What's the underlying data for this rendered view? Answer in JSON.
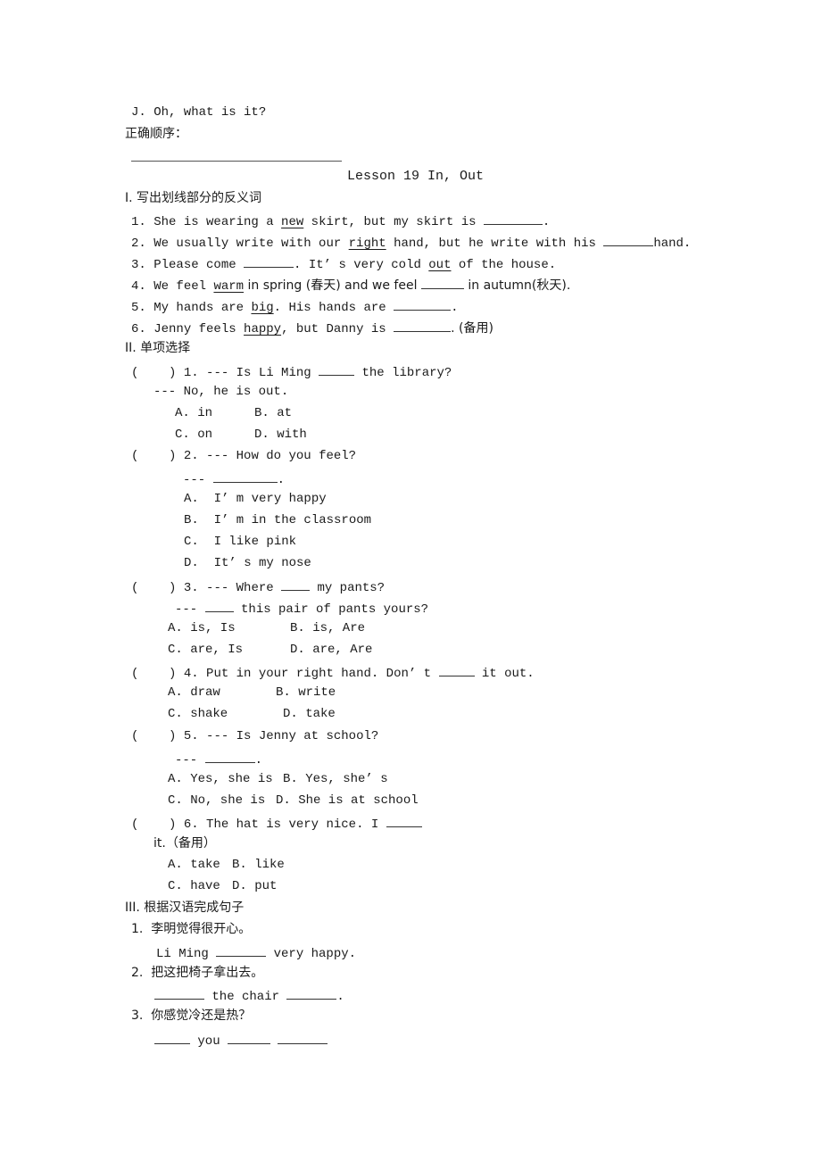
{
  "top": {
    "item_j": "J. Oh, what is it?",
    "order_label": "正确顺序："
  },
  "lesson_title": "Lesson 19 In, Out",
  "section1": {
    "heading": "I. 写出划线部分的反义词",
    "items": [
      {
        "num": "1.",
        "pre": "She is wearing a ",
        "underlined": "new",
        "post": " skirt, but my skirt is ",
        "end": "."
      },
      {
        "num": "2.",
        "pre": "We usually write with our ",
        "underlined": "right",
        "post": " hand, but he write with his ",
        "end": "hand."
      },
      {
        "num": "3.",
        "pre": "Please come ",
        "mid": ". It’ s very cold ",
        "underlined": "out",
        "post": " of the house."
      },
      {
        "num": "4.",
        "pre": "We feel ",
        "underlined": "warm",
        "post": " in spring (春天) and we feel ",
        "end": " in autumn(秋天)."
      },
      {
        "num": "5.",
        "pre": "My hands are ",
        "underlined": "big",
        "post": ". His hands are ",
        "end": "."
      },
      {
        "num": "6.",
        "pre": "Jenny feels ",
        "underlined": "happy",
        "post": ", but Danny is ",
        "end": ". (备用)"
      }
    ]
  },
  "section2": {
    "heading": "II. 单项选择",
    "questions": [
      {
        "bracket": "(    )",
        "num": "1.",
        "q_pre": "--- Is Li Ming ",
        "q_post": " the library?",
        "answer_line": "--- No, he is out.",
        "options": [
          "A. in",
          "B. at",
          "C. on",
          "D. with"
        ]
      },
      {
        "bracket": "(    )",
        "num": "2.",
        "q": "--- How do you feel?",
        "answer_prefix": "--- ",
        "answer_end": ".",
        "options": [
          "A.  I’ m very happy",
          "B.  I’ m in the classroom",
          "C.  I like pink",
          "D.  It’ s my nose"
        ]
      },
      {
        "bracket": "(    )",
        "num": "3.",
        "q_pre": "--- Where ",
        "q_post": " my pants?",
        "answer_prefix": "--- ",
        "answer_post": " this pair of pants yours?",
        "options": [
          "A. is, Is",
          "B. is, Are",
          "C. are, Is",
          "D. are, Are"
        ]
      },
      {
        "bracket": "(    )",
        "num": "4.",
        "q_pre": "Put in your right hand. Don’ t ",
        "q_post": " it out.",
        "options": [
          "A. draw",
          "B. write",
          "C. shake",
          "D. take"
        ]
      },
      {
        "bracket": "(    )",
        "num": "5.",
        "q": "--- Is Jenny at school?",
        "answer_prefix": "--- ",
        "answer_end": ".",
        "options": [
          "A. Yes, she is",
          "B. Yes, she’ s",
          "C. No, she is",
          "D. She is at school"
        ]
      },
      {
        "bracket": "(    )",
        "num": "6.",
        "q_pre": "The hat is very nice. I ",
        "continuation": "it.（备用）",
        "options": [
          "A. take",
          "B. like",
          "C. have",
          "D. put"
        ]
      }
    ]
  },
  "section3": {
    "heading": "III. 根据汉语完成句子",
    "items": [
      {
        "num": "1.",
        "chinese": "李明觉得很开心。",
        "en_pre": "Li Ming ",
        "en_post": " very happy."
      },
      {
        "num": "2.",
        "chinese": "把这把椅子拿出去。",
        "en_mid": " the chair ",
        "en_end": "."
      },
      {
        "num": "3.",
        "chinese": "你感觉冷还是热？",
        "en_mid": " you "
      }
    ]
  }
}
